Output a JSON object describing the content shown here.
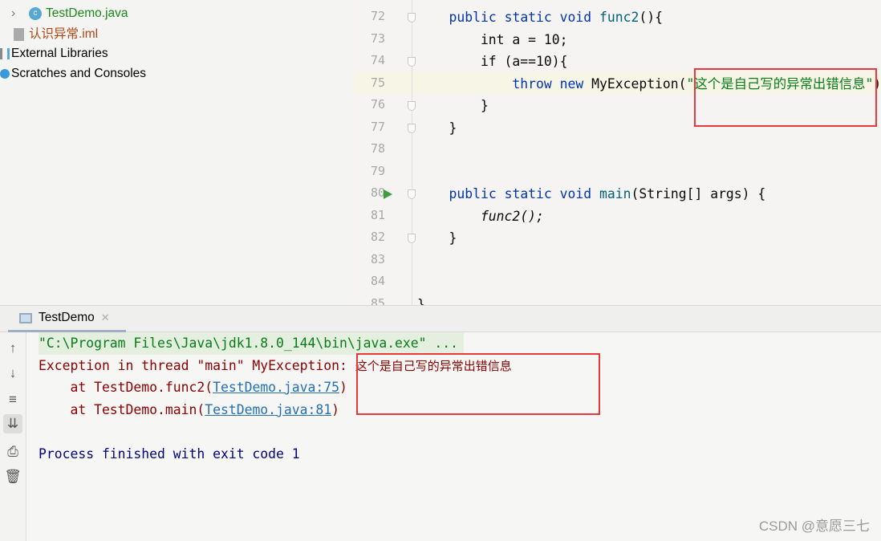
{
  "project_tree": {
    "items": [
      {
        "label": "TestDemo.java",
        "icon": "java-class-icon",
        "color": "#1b8a1b"
      },
      {
        "label": "认识异常.iml",
        "icon": "iml-file-icon",
        "color": "#b0440f"
      },
      {
        "label": "External Libraries",
        "icon": "library-icon"
      },
      {
        "label": "Scratches and Consoles",
        "icon": "scratches-icon"
      }
    ]
  },
  "editor": {
    "lines": [
      {
        "n": "72",
        "text": "    public static void func2(){"
      },
      {
        "n": "73",
        "text": "        int a = 10;"
      },
      {
        "n": "74",
        "text": "        if (a==10){"
      },
      {
        "n": "75",
        "text": "            throw new MyException(\"这个是自己写的异常出错信息\")"
      },
      {
        "n": "76",
        "text": "        }"
      },
      {
        "n": "77",
        "text": "    }"
      },
      {
        "n": "78",
        "text": ""
      },
      {
        "n": "79",
        "text": ""
      },
      {
        "n": "80",
        "text": "    public static void main(String[] args) {"
      },
      {
        "n": "81",
        "text": "        func2();"
      },
      {
        "n": "82",
        "text": "    }"
      },
      {
        "n": "83",
        "text": ""
      },
      {
        "n": "84",
        "text": ""
      },
      {
        "n": "85",
        "text": "}"
      }
    ]
  },
  "console": {
    "tab_label": "TestDemo",
    "cmd": "\"C:\\Program Files\\Java\\jdk1.8.0_144\\bin\\java.exe\" ...",
    "exc_prefix": "Exception in thread \"main\" MyException: ",
    "exc_msg": "这个是自己写的异常出错信息",
    "trace": [
      {
        "pre": "    at TestDemo.func2(",
        "link": "TestDemo.java:75",
        "post": ")"
      },
      {
        "pre": "    at TestDemo.main(",
        "link": "TestDemo.java:81",
        "post": ")"
      }
    ],
    "finish": "Process finished with exit code 1"
  },
  "colors": {
    "error": "#8b0000",
    "accent_highlight": "#e8383b",
    "finish": "#000080"
  },
  "watermark": "CSDN @意愿三七"
}
